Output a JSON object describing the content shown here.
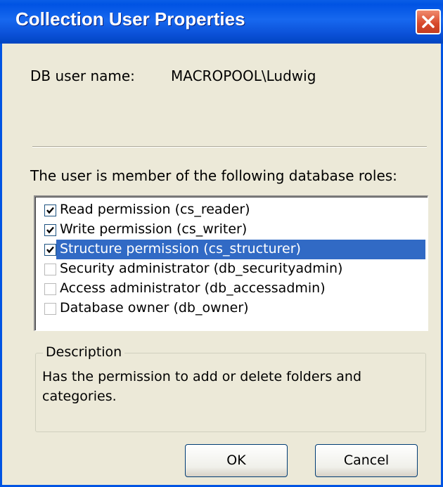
{
  "window": {
    "title": "Collection User Properties"
  },
  "db_user": {
    "label": "DB user name:",
    "value": "MACROPOOL\\Ludwig"
  },
  "roles": {
    "heading": "The user is member of the following database roles:",
    "items": [
      {
        "label": "Read permission (cs_reader)",
        "checked": true,
        "selected": false
      },
      {
        "label": "Write permission (cs_writer)",
        "checked": true,
        "selected": false
      },
      {
        "label": "Structure permission (cs_structurer)",
        "checked": true,
        "selected": true
      },
      {
        "label": "Security administrator  (db_securityadmin)",
        "checked": false,
        "selected": false
      },
      {
        "label": "Access administrator (db_accessadmin)",
        "checked": false,
        "selected": false
      },
      {
        "label": "Database owner (db_owner)",
        "checked": false,
        "selected": false
      }
    ]
  },
  "description": {
    "legend": "Description",
    "text": "Has the permission to add or delete folders and categories."
  },
  "buttons": {
    "ok": "OK",
    "cancel": "Cancel"
  },
  "colors": {
    "titlebar": "#0054e3",
    "selection": "#316ac5",
    "dialog_bg": "#ece9d8",
    "close": "#d7482a"
  }
}
